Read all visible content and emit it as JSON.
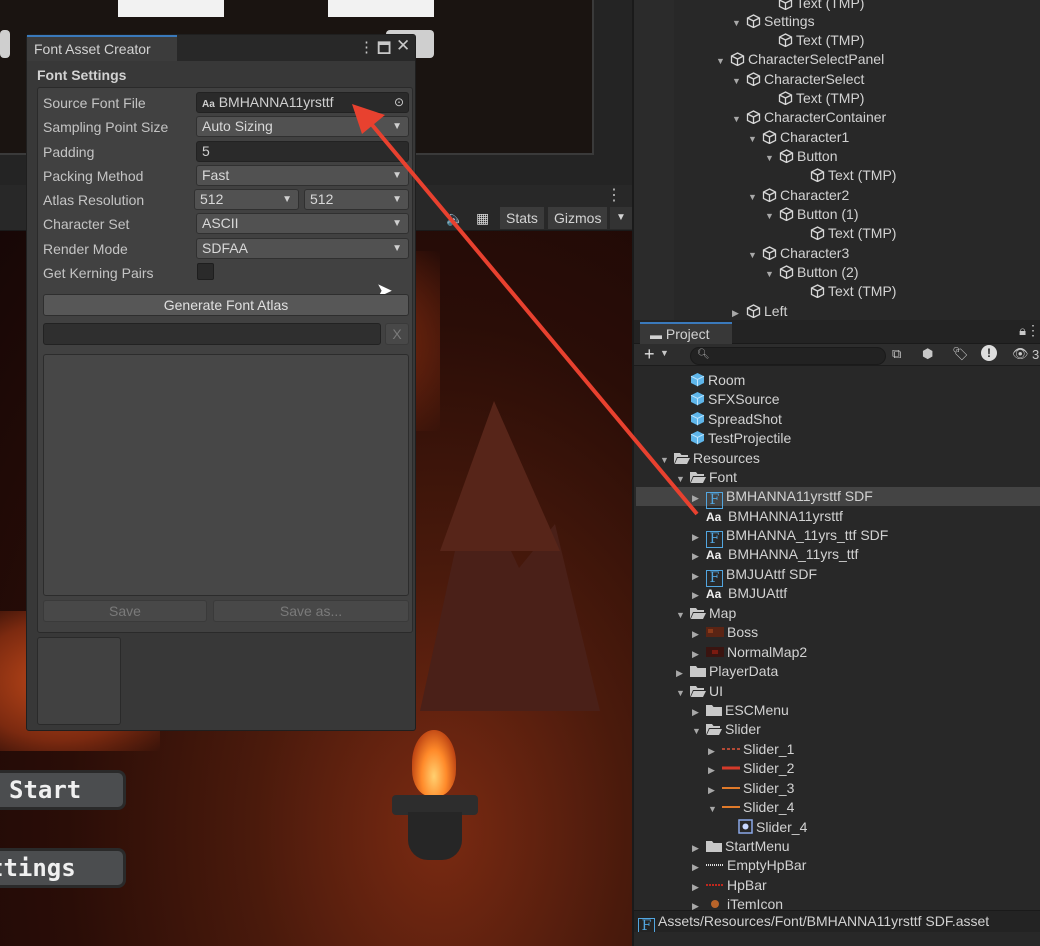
{
  "game_view": {
    "toolbar": {
      "stats": "Stats",
      "gizmos": "Gizmos"
    },
    "buttons": {
      "start": "Start",
      "settings": "ttings"
    }
  },
  "font_asset_creator": {
    "title": "Font Asset Creator",
    "section": "Font Settings",
    "fields": {
      "source_font_file": {
        "label": "Source Font File",
        "value": "BMHANNA11yrsttf",
        "icon": "Aa"
      },
      "sampling_point_size": {
        "label": "Sampling Point Size",
        "value": "Auto Sizing"
      },
      "padding": {
        "label": "Padding",
        "value": "5"
      },
      "packing_method": {
        "label": "Packing Method",
        "value": "Fast"
      },
      "atlas_resolution": {
        "label": "Atlas Resolution",
        "width": "512",
        "height": "512"
      },
      "character_set": {
        "label": "Character Set",
        "value": "ASCII"
      },
      "render_mode": {
        "label": "Render Mode",
        "value": "SDFAA"
      },
      "get_kerning_pairs": {
        "label": "Get Kerning Pairs",
        "checked": false
      }
    },
    "generate_button": "Generate Font Atlas",
    "clear_button": "X",
    "save_button": "Save",
    "save_as_button": "Save as..."
  },
  "hierarchy": {
    "items": [
      "Text (TMP)",
      "Settings",
      "Text (TMP)",
      "CharacterSelectPanel",
      "CharacterSelect",
      "Text (TMP)",
      "CharacterContainer",
      "Character1",
      "Button",
      "Text (TMP)",
      "Character2",
      "Button (1)",
      "Text (TMP)",
      "Character3",
      "Button (2)",
      "Text (TMP)",
      "Left"
    ]
  },
  "project": {
    "tab": "Project",
    "items": [
      "Room",
      "SFXSource",
      "SpreadShot",
      "TestProjectile",
      "Resources",
      "Font",
      "BMHANNA11yrsttf SDF",
      "BMHANNA11yrsttf",
      "BMHANNA_11yrs_ttf SDF",
      "BMHANNA_11yrs_ttf",
      "BMJUAttf SDF",
      "BMJUAttf",
      "Map",
      "Boss",
      "NormalMap2",
      "PlayerData",
      "UI",
      "ESCMenu",
      "Slider",
      "Slider_1",
      "Slider_2",
      "Slider_3",
      "Slider_4",
      "Slider_4",
      "StartMenu",
      "EmptyHpBar",
      "HpBar",
      "iTemIcon"
    ],
    "hidden_count": "3",
    "status_path": "Assets/Resources/Font/BMHANNA11yrsttf SDF.asset"
  },
  "colors": {
    "accent_blue": "#3a79bb",
    "annotation_red": "#e8412f",
    "font_asset_blue": "#52a6e0"
  }
}
